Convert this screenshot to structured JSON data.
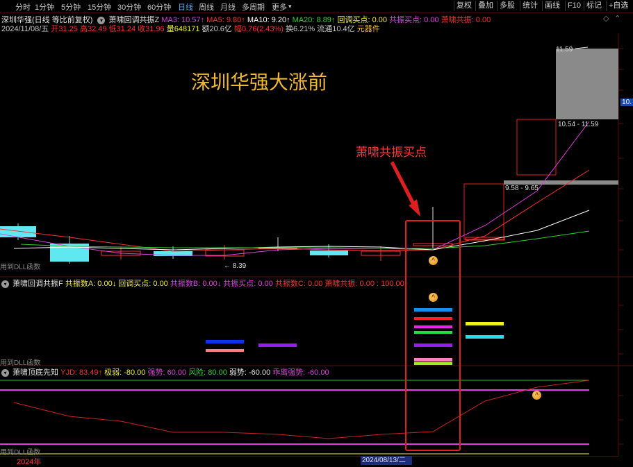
{
  "periods": [
    "分时",
    "1分钟",
    "5分钟",
    "15分钟",
    "30分钟",
    "60分钟",
    "日线",
    "周线",
    "月线",
    "多周期",
    "更多"
  ],
  "active_period": "日线",
  "right_buttons": [
    "复权",
    "叠加",
    "多股",
    "统计",
    "画线",
    "F10",
    "标记",
    "+自选"
  ],
  "header": {
    "stock": "深圳华强(日线 等比前复权)",
    "indicator": "萧啸回调共振Z",
    "ma3": "MA3: 10.57↑",
    "ma5": "MA5: 9.80↑",
    "ma10": "MA10: 9.20↑",
    "ma20": "MA20: 8.89↑",
    "huitiao": "回调买点: 0.00",
    "gongzhen": "共振买点: 0.00",
    "xiaoxiao": "萧啸共振: 0.00"
  },
  "info": {
    "date": "2024/11/08/五",
    "open": "开31.25",
    "high": "高32.49",
    "low": "低31.24",
    "close": "收31.96",
    "volume": "量648171",
    "amount": "额20.6亿",
    "change": "幅0.76(2.43%)",
    "turnover": "换6.21%",
    "float": "流通10.4亿",
    "sector": "元器件"
  },
  "annotations": {
    "title": "深圳华强大涨前",
    "callout": "萧啸共振买点",
    "low_label": "8.39",
    "box1": "9.58 - 9.65",
    "box2": "10.54 - 11.59",
    "top_label": "11.59",
    "right_price": "10."
  },
  "panel2": {
    "indicator": "萧啸回调共振F",
    "a": "共振数A: 0.00↓",
    "huitiao": "回调买点: 0.00",
    "b": "共振数B: 0.00↓",
    "gongzhen": "共振买点: 0.00",
    "c": "共振数C: 0.00",
    "xiaoxiao": "萧啸共振: 0.00 : 100.00"
  },
  "panel3": {
    "indicator": "萧啸顶底先知",
    "yjd": "YJD: 83.49↑",
    "jiruo": "极弱: -80.00",
    "qiangshi": "强势: 60.00",
    "fengxian": "风险: 80.00",
    "ruoshi": "弱势: -60.00",
    "beili": "乖离强势: -60.00"
  },
  "dll_text": "用到DLL函数",
  "axis": {
    "year": "2024年",
    "date": "2024/08/13/二"
  },
  "colors": {
    "up": "#ff3030",
    "down": "#40e0f0",
    "ma3": "#e040e0",
    "ma10": "#ffffff",
    "ma20": "#30d030",
    "highlight": "#e02020",
    "accent": "#f0b838"
  }
}
